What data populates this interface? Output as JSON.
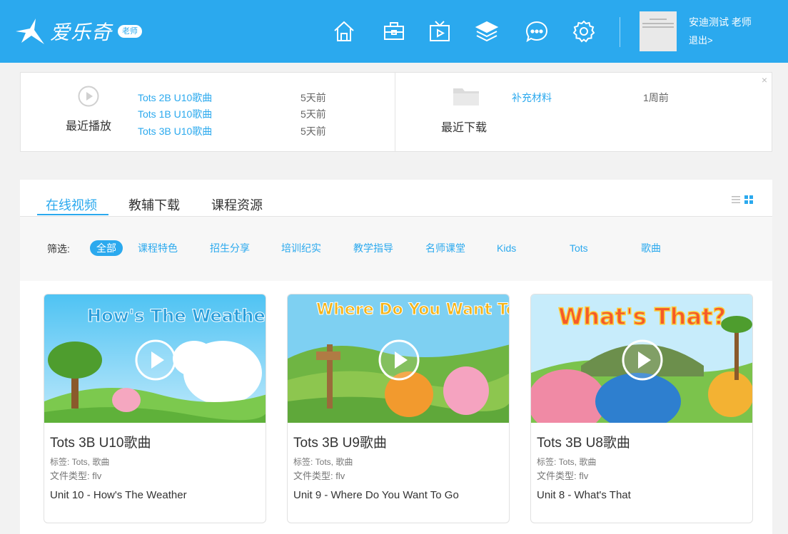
{
  "header": {
    "logo_text": "爱乐奇",
    "logo_badge": "老师",
    "nav_icons": [
      "home-icon",
      "toolbox-icon",
      "tv-icon",
      "layers-icon",
      "chat-icon",
      "settings-icon"
    ],
    "user_name": "安迪测试 老师",
    "logout": "退出>"
  },
  "recent": {
    "played_title": "最近播放",
    "played": [
      {
        "name": "Tots 2B U10歌曲",
        "time": "5天前"
      },
      {
        "name": "Tots 1B U10歌曲",
        "time": "5天前"
      },
      {
        "name": "Tots 3B U10歌曲",
        "time": "5天前"
      }
    ],
    "downloaded_title": "最近下载",
    "downloaded": [
      {
        "name": "补充材料",
        "time": "1周前"
      }
    ],
    "close": "×"
  },
  "tabs": [
    "在线视频",
    "教辅下载",
    "课程资源"
  ],
  "filter": {
    "label": "筛选:",
    "chips": [
      "全部",
      "课程特色",
      "招生分享",
      "培训纪实",
      "教学指导",
      "名师课堂",
      "Kids",
      "Tots",
      "歌曲"
    ]
  },
  "cards": [
    {
      "title": "Tots 3B U10歌曲",
      "tags": "标签: Tots, 歌曲",
      "file_type": "文件类型:  flv",
      "desc": "Unit 10 - How's The Weather",
      "thumb_text": "How's The Weather?"
    },
    {
      "title": "Tots 3B U9歌曲",
      "tags": "标签: Tots, 歌曲",
      "file_type": "文件类型:  flv",
      "desc": "Unit 9 - Where Do You Want To Go",
      "thumb_text": "Where Do You Want To Go?"
    },
    {
      "title": "Tots 3B U8歌曲",
      "tags": "标签: Tots, 歌曲",
      "file_type": "文件类型:  flv",
      "desc": "Unit 8 - What's That",
      "thumb_text": "What's That?"
    }
  ],
  "colors": {
    "accent": "#2ba9ee",
    "header_bg": "#2ba9ee"
  }
}
